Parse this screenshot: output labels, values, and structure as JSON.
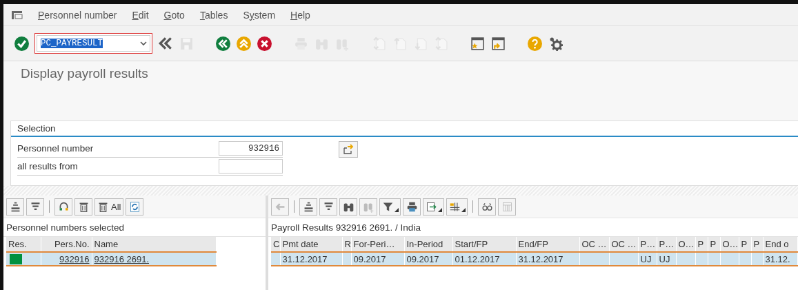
{
  "menu": [
    {
      "label": "Personnel number"
    },
    {
      "label": "Edit"
    },
    {
      "label": "Goto"
    },
    {
      "label": "Tables"
    },
    {
      "label": "System"
    },
    {
      "label": "Help"
    }
  ],
  "toolbar": {
    "command_field": {
      "value": "PC_PAYRESULT"
    },
    "buttons": [
      {
        "kind": "enter",
        "disabled": false
      },
      {
        "kind": "field"
      },
      {
        "kind": "chevrons",
        "disabled": false
      },
      {
        "kind": "save",
        "disabled": true
      },
      {
        "kind": "sep"
      },
      {
        "kind": "back",
        "disabled": false
      },
      {
        "kind": "exit",
        "disabled": false
      },
      {
        "kind": "cancel",
        "disabled": false
      },
      {
        "kind": "sep"
      },
      {
        "kind": "print",
        "disabled": true
      },
      {
        "kind": "find",
        "disabled": true
      },
      {
        "kind": "findnext",
        "disabled": true
      },
      {
        "kind": "sep"
      },
      {
        "kind": "first",
        "disabled": true
      },
      {
        "kind": "prev",
        "disabled": true
      },
      {
        "kind": "next",
        "disabled": true
      },
      {
        "kind": "last",
        "disabled": true
      },
      {
        "kind": "sep"
      },
      {
        "kind": "session",
        "disabled": false
      },
      {
        "kind": "shortcut",
        "disabled": false
      },
      {
        "kind": "sep"
      },
      {
        "kind": "help",
        "disabled": false
      },
      {
        "kind": "settings",
        "disabled": false
      }
    ]
  },
  "title": "Display payroll results",
  "selection": {
    "title": "Selection",
    "fields": [
      {
        "label": "Personnel number",
        "value": "932916"
      },
      {
        "label": "all results from"
      }
    ]
  },
  "left_panel": {
    "toolbar": [
      {
        "kind": "sortasc",
        "disabled": false
      },
      {
        "kind": "sortdesc",
        "disabled": false
      },
      {
        "kind": "sep"
      },
      {
        "kind": "link",
        "disabled": false
      },
      {
        "kind": "delete",
        "disabled": false
      },
      {
        "kind": "deleteall",
        "disabled": false,
        "label": "All"
      },
      {
        "kind": "refresh",
        "disabled": false
      }
    ],
    "title": "Personnel numbers selected",
    "columns": [
      "Res.",
      "Pers.No.",
      "Name"
    ],
    "rows": [
      {
        "selected": true,
        "color": "#00913f",
        "cells": [
          null,
          "932916",
          "932916 2691."
        ]
      }
    ]
  },
  "right_panel": {
    "toolbar": [
      {
        "kind": "arrowleft",
        "disabled": true
      },
      {
        "kind": "sep"
      },
      {
        "kind": "sortasc",
        "disabled": false
      },
      {
        "kind": "sortdesc",
        "disabled": false
      },
      {
        "kind": "find",
        "disabled": false
      },
      {
        "kind": "findnext",
        "disabled": true
      },
      {
        "kind": "filter",
        "disabled": false
      },
      {
        "kind": "print",
        "disabled": false
      },
      {
        "kind": "export",
        "disabled": false
      },
      {
        "kind": "layout",
        "disabled": false
      },
      {
        "kind": "sep"
      },
      {
        "kind": "details",
        "disabled": false
      },
      {
        "kind": "grid",
        "disabled": true
      }
    ],
    "title": "Payroll Results 932916 2691. / India",
    "columns": [
      "C",
      "Pmt date",
      "R",
      "For-Peri…",
      "In-Period",
      "Start/FP",
      "End/FP",
      "OC …",
      "OC …",
      "P…",
      "P…",
      "O…",
      "P",
      "P",
      "O…",
      "P",
      "P",
      "End o"
    ],
    "rows": [
      {
        "selected": true,
        "cells": [
          null,
          "31.12.2017",
          null,
          "09.2017",
          "09.2017",
          "01.12.2017",
          "31.12.2017",
          null,
          null,
          "UJ",
          "UJ",
          null,
          null,
          null,
          null,
          null,
          null,
          "31.12."
        ]
      }
    ]
  }
}
